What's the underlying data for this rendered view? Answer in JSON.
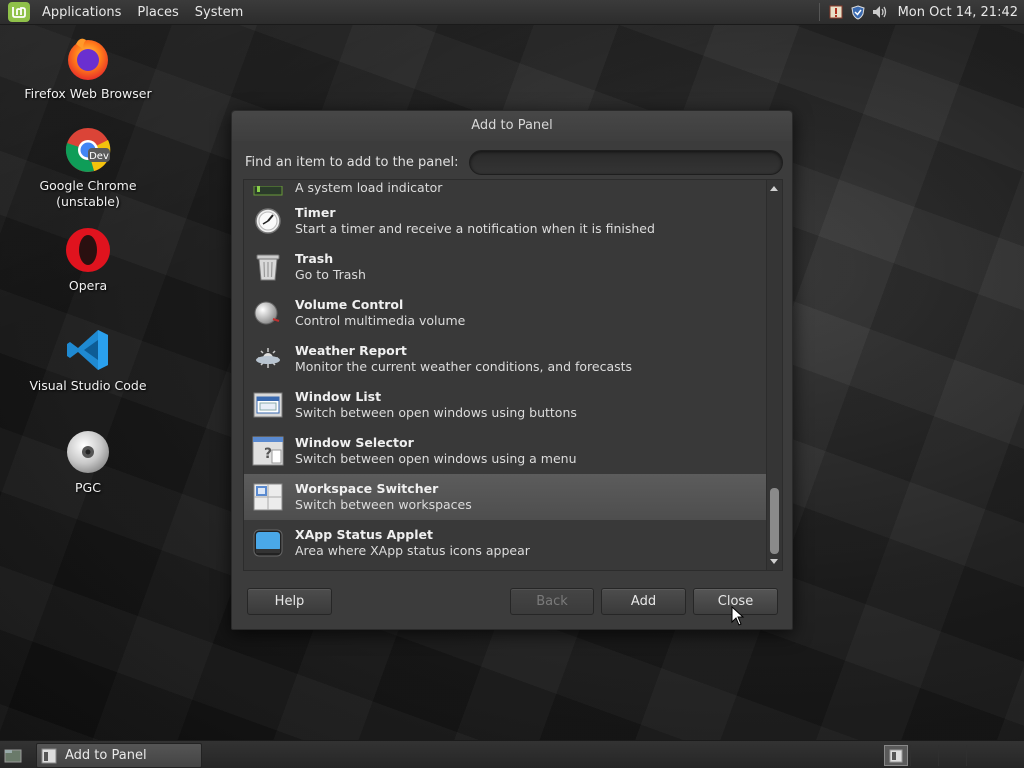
{
  "top_panel": {
    "menus": [
      "Applications",
      "Places",
      "System"
    ],
    "clock": "Mon Oct 14, 21:42"
  },
  "desktop": {
    "icons": [
      {
        "label": "Firefox Web Browser",
        "icon": "firefox-icon"
      },
      {
        "label": "Google Chrome\n(unstable)",
        "icon": "chrome-dev-icon",
        "badge": "Dev"
      },
      {
        "label": "Opera",
        "icon": "opera-icon"
      },
      {
        "label": "Visual Studio Code",
        "icon": "vscode-icon"
      },
      {
        "label": "PGC",
        "icon": "cd-icon"
      }
    ]
  },
  "dialog": {
    "title": "Add to Panel",
    "find_label": "Find an item to add to the panel:",
    "search_value": "",
    "items": [
      {
        "title": "",
        "desc": "A system load indicator",
        "icon": "system-monitor-icon"
      },
      {
        "title": "Timer",
        "desc": "Start a timer and receive a notification when it is finished",
        "icon": "timer-icon"
      },
      {
        "title": "Trash",
        "desc": "Go to Trash",
        "icon": "trash-icon"
      },
      {
        "title": "Volume Control",
        "desc": "Control multimedia volume",
        "icon": "volume-icon"
      },
      {
        "title": "Weather Report",
        "desc": "Monitor the current weather conditions, and forecasts",
        "icon": "weather-icon"
      },
      {
        "title": "Window List",
        "desc": "Switch between open windows using buttons",
        "icon": "window-list-icon"
      },
      {
        "title": "Window Selector",
        "desc": "Switch between open windows using a menu",
        "icon": "window-selector-icon"
      },
      {
        "title": "Workspace Switcher",
        "desc": "Switch between workspaces",
        "icon": "workspace-switcher-icon",
        "selected": true
      },
      {
        "title": "XApp Status Applet",
        "desc": "Area where XApp status icons appear",
        "icon": "xapp-status-icon"
      }
    ],
    "buttons": {
      "help": "Help",
      "back": "Back",
      "add": "Add",
      "close": "Close"
    }
  },
  "bottom_panel": {
    "task": "Add to Panel"
  },
  "colors": {
    "mint_green": "#8fc14a",
    "selection": "#555555"
  }
}
